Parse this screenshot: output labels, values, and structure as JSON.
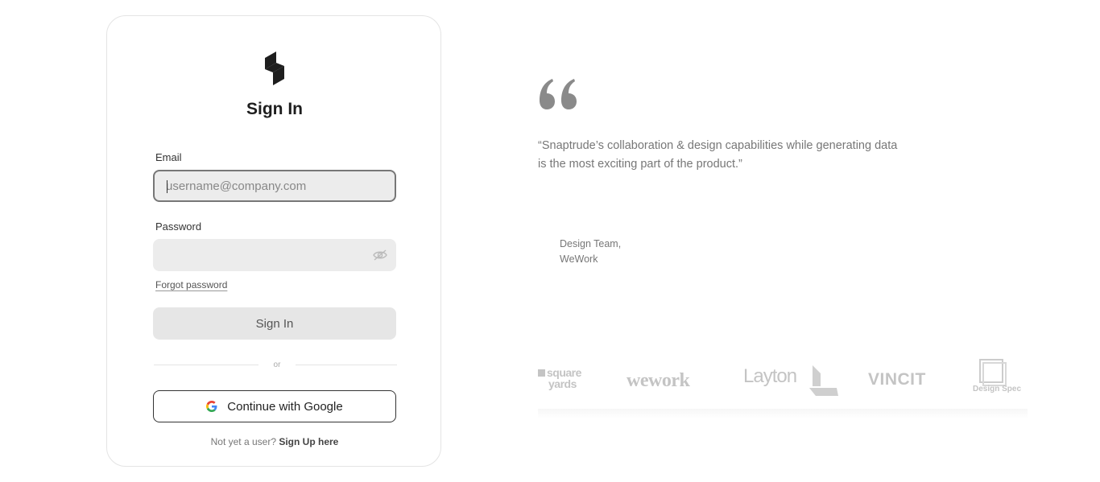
{
  "signin": {
    "title": "Sign In",
    "email_label": "Email",
    "email_placeholder": "username@company.com",
    "password_label": "Password",
    "forgot_password": "Forgot password",
    "submit_label": "Sign In",
    "divider_text": "or",
    "google_label": "Continue with Google",
    "signup_prompt": "Not yet a user?",
    "signup_link": "Sign Up here"
  },
  "testimonial": {
    "quote": "“Snaptrude’s collaboration & design capabilities while generating data is the most exciting part of the product.”",
    "author_line1": "Design Team,",
    "author_line2": "WeWork"
  },
  "clients": [
    {
      "name": "square yards",
      "line1": "square",
      "line2": "yards"
    },
    {
      "name": "wework"
    },
    {
      "name": "Layton"
    },
    {
      "name": "VINCIT"
    },
    {
      "name": "Design Spec"
    }
  ],
  "colors": {
    "card_border": "#e4e4e4",
    "field_bg": "#ececec",
    "muted_text": "#777777",
    "logo": "#1e1e1e"
  },
  "icons": [
    "snaptrude-logo-icon",
    "eye-hidden-icon",
    "google-icon",
    "quote-icon"
  ]
}
